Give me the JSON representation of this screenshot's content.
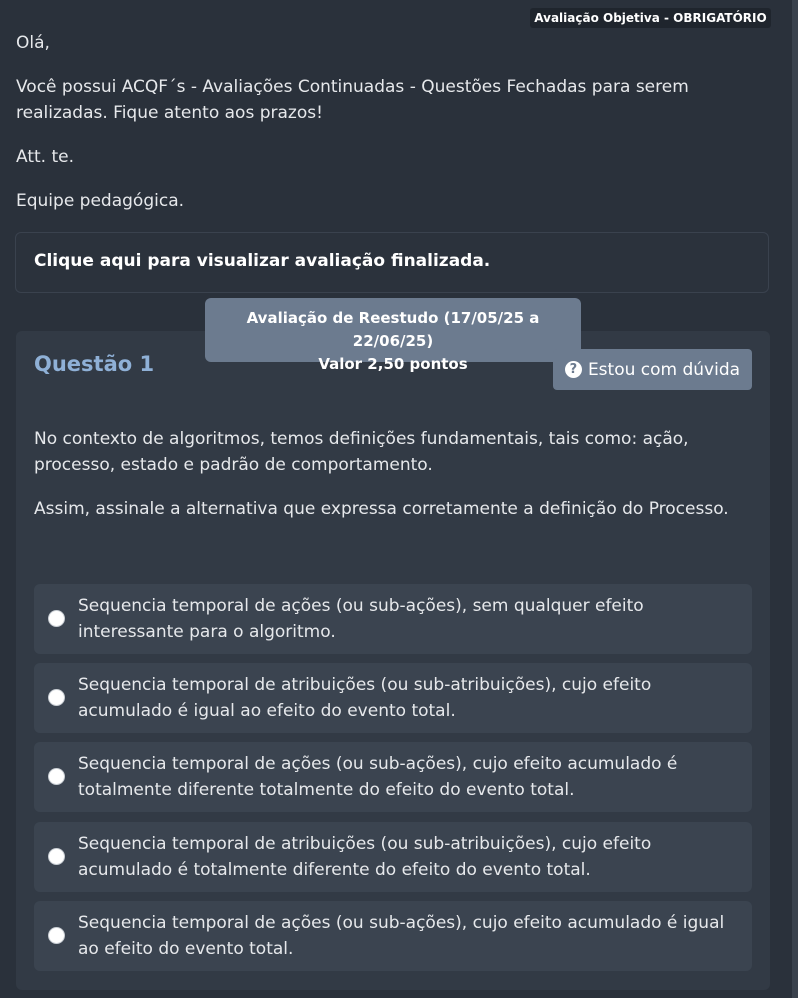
{
  "header": {
    "badge": "Avaliação Objetiva - OBRIGATÓRIO"
  },
  "message": {
    "greeting": "Olá,",
    "body": "Você possui ACQF´s - Avaliações Continuadas - Questões Fechadas para serem realizadas. Fique atento aos prazos!",
    "regards": "Att. te.",
    "team": "Equipe pedagógica."
  },
  "finalized": {
    "link_label": "Clique aqui para visualizar avaliação finalizada."
  },
  "reestudo": {
    "title": "Avaliação de Reestudo (17/05/25 a 22/06/25)",
    "value": "Valor 2,50 pontos"
  },
  "question": {
    "title": "Questão 1",
    "doubt_button": "Estou com dúvida",
    "doubt_icon": "question-circle-icon",
    "statement": "No contexto de algoritmos, temos definições fundamentais, tais como: ação, processo, estado e padrão de comportamento.",
    "prompt": "Assim, assinale a alternativa que expressa corretamente a definição do Processo.",
    "options": [
      {
        "label": "Sequencia temporal de ações (ou sub-ações), sem qualquer efeito interessante para o algoritmo.",
        "selected": false
      },
      {
        "label": "Sequencia temporal de atribuições (ou sub-atribuições), cujo efeito acumulado é igual ao efeito do evento total.",
        "selected": false
      },
      {
        "label": "Sequencia temporal de ações (ou sub-ações), cujo efeito acumulado é totalmente diferente totalmente do efeito do evento total.",
        "selected": false
      },
      {
        "label": "Sequencia temporal de atribuições (ou sub-atribuições), cujo efeito acumulado é totalmente diferente do efeito do evento total.",
        "selected": false
      },
      {
        "label": "Sequencia temporal de ações (ou sub-ações), cujo efeito acumulado é igual ao efeito do evento total.",
        "selected": false
      }
    ]
  },
  "colors": {
    "background": "#2a313b",
    "card": "#323a45",
    "option": "#3b4450",
    "accent_button": "#6c7b8f",
    "question_title": "#8fb0d6"
  }
}
